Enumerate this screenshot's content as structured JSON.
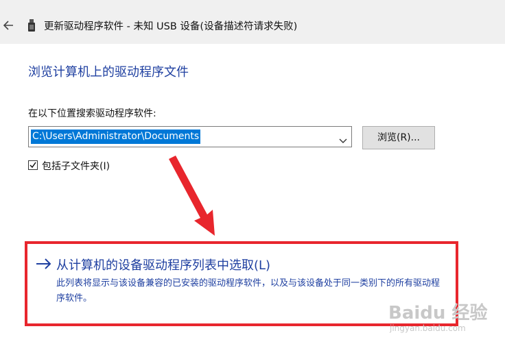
{
  "window": {
    "title": "更新驱动程序软件 - 未知 USB 设备(设备描述符请求失败)"
  },
  "page": {
    "heading": "浏览计算机上的驱动程序文件",
    "search_label": "在以下位置搜索驱动程序软件:",
    "path_value": "C:\\Users\\Administrator\\Documents",
    "browse_label": "浏览(R)...",
    "include_subfolders_label": "包括子文件夹(I)",
    "include_subfolders_checked": true,
    "pick_link": "从计算机的设备驱动程序列表中选取(L)",
    "pick_desc": "此列表将显示与该设备兼容的已安装的驱动程序软件，以及与该设备处于同一类别下的所有驱动程序软件。"
  },
  "annotation": {
    "color": "#e8262d"
  },
  "watermark": {
    "logo": "Baidu 经验",
    "sub": "jingyan.baidu.com"
  },
  "colors": {
    "link": "#1e3fa0",
    "selection": "#0078d7",
    "titlebar": "#f0f0f0"
  }
}
